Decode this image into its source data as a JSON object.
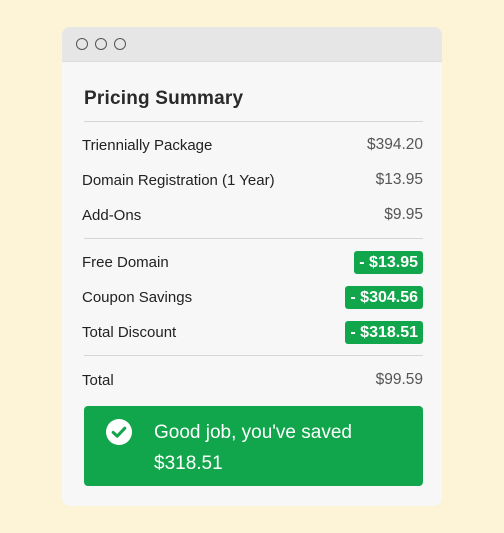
{
  "window": {
    "dots": [
      "",
      "",
      ""
    ]
  },
  "summary": {
    "title": "Pricing Summary",
    "items": [
      {
        "label": "Triennially Package",
        "amount": "$394.20"
      },
      {
        "label": "Domain Registration (1 Year)",
        "amount": "$13.95"
      },
      {
        "label": "Add-Ons",
        "amount": "$9.95"
      }
    ],
    "discounts": [
      {
        "label": "Free Domain",
        "amount": "- $13.95"
      },
      {
        "label": "Coupon Savings",
        "amount": "- $304.56"
      },
      {
        "label": "Total Discount",
        "amount": "- $318.51"
      }
    ],
    "total": {
      "label": "Total",
      "amount": "$99.59"
    }
  },
  "banner": {
    "line1": "Good job, you've saved",
    "line2": "$318.51"
  },
  "colors": {
    "background": "#fdf3d7",
    "accent_green": "#11a64b",
    "panel": "#f7f7f7"
  },
  "icons": {
    "banner_icon": "check-circle-icon"
  }
}
